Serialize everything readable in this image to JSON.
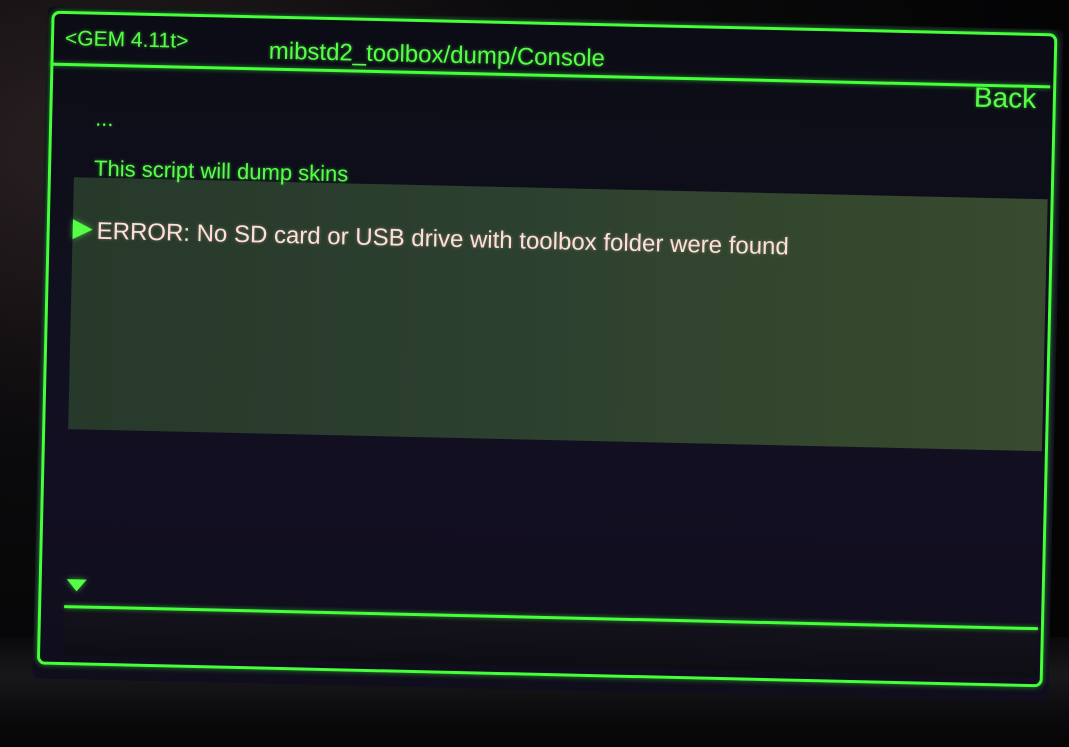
{
  "header": {
    "version": "<GEM 4.11t>",
    "title": "mibstd2_toolbox/dump/Console",
    "back_label": "Back"
  },
  "console": {
    "lines": [
      "...",
      "This script will dump skins",
      "ERROR: No SD card or USB drive with toolbox folder were found"
    ],
    "selected_index": 2
  },
  "icons": {
    "selection_pointer": "pointer-arrow-icon",
    "scroll_down": "scroll-down-triangle-icon"
  },
  "colors": {
    "accent": "#45ff3a",
    "text": "#55ff45",
    "error_text": "#ffdfd6",
    "selection_bg": "#2c4030"
  }
}
